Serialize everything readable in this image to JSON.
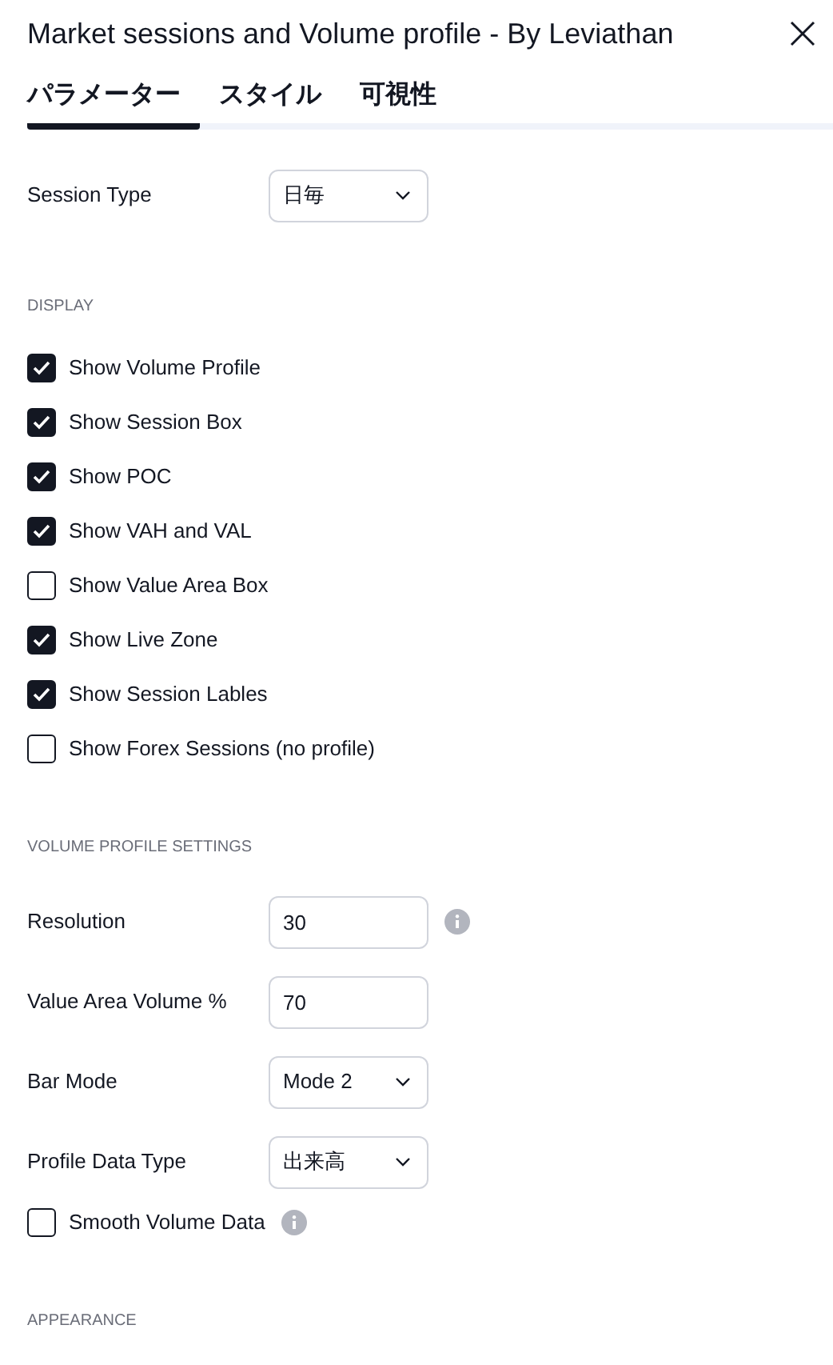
{
  "window": {
    "title": "Market sessions and Volume profile - By Leviathan"
  },
  "tabs": [
    {
      "label": "パラメーター",
      "selected": true
    },
    {
      "label": "スタイル",
      "selected": false
    },
    {
      "label": "可視性",
      "selected": false
    }
  ],
  "sections": [
    {
      "rows": [
        {
          "kind": "select",
          "label": "Session Type",
          "value": "日毎"
        }
      ]
    },
    {
      "heading": "DISPLAY",
      "rows": [
        {
          "kind": "checkbox",
          "label": "Show Volume Profile",
          "checked": true
        },
        {
          "kind": "checkbox",
          "label": "Show Session Box",
          "checked": true
        },
        {
          "kind": "checkbox",
          "label": "Show POC",
          "checked": true
        },
        {
          "kind": "checkbox",
          "label": "Show VAH and VAL",
          "checked": true
        },
        {
          "kind": "checkbox",
          "label": "Show Value Area Box",
          "checked": false
        },
        {
          "kind": "checkbox",
          "label": "Show Live Zone",
          "checked": true
        },
        {
          "kind": "checkbox",
          "label": "Show Session Lables",
          "checked": true
        },
        {
          "kind": "checkbox",
          "label": "Show Forex Sessions (no profile)",
          "checked": false
        }
      ]
    },
    {
      "heading": "VOLUME PROFILE SETTINGS",
      "rows": [
        {
          "kind": "input",
          "label": "Resolution",
          "value": "30",
          "info": true
        },
        {
          "kind": "input",
          "label": "Value Area Volume %",
          "value": "70"
        },
        {
          "kind": "select",
          "label": "Bar Mode",
          "value": "Mode 2"
        },
        {
          "kind": "select",
          "label": "Profile Data Type",
          "value": "出来高"
        },
        {
          "kind": "checkbox",
          "label": "Smooth Volume Data",
          "checked": false,
          "info": true
        }
      ]
    },
    {
      "heading": "APPEARANCE"
    }
  ]
}
